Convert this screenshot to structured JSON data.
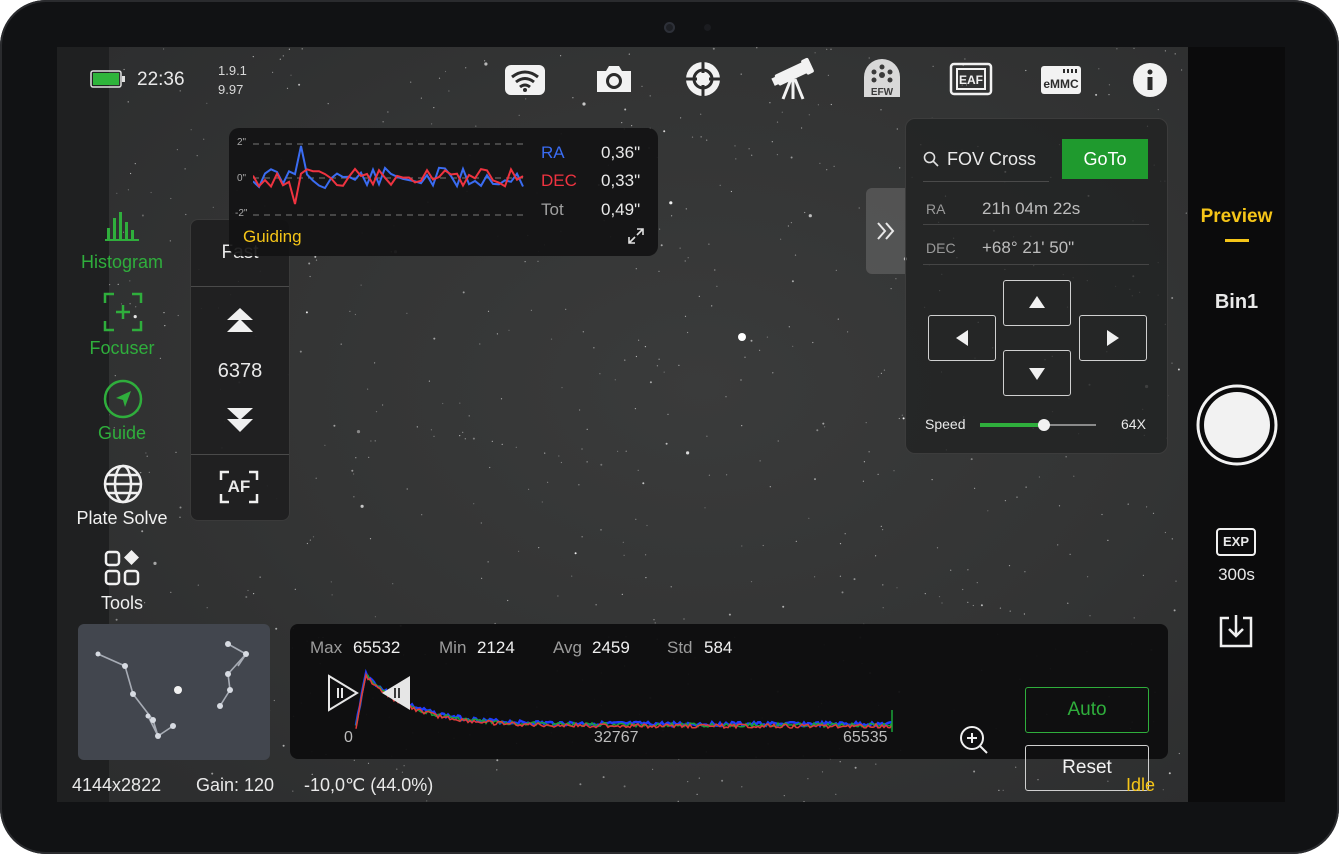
{
  "status_bar": {
    "time": "22:36",
    "version_line1": "1.9.1",
    "version_line2": "9.97",
    "battery_color": "#2fb43b"
  },
  "toolbar_icons": [
    "wifi-icon",
    "camera-icon",
    "crosshair-icon",
    "telescope-icon",
    "efw-icon",
    "eaf-icon",
    "emmc-icon",
    "info-icon"
  ],
  "toolbar_labels": {
    "efw": "EFW",
    "eaf": "EAF",
    "emmc": "eMMC"
  },
  "guiding": {
    "title": "Guiding",
    "axis_top": "2\"",
    "axis_mid": "0\"",
    "axis_bottom": "-2\"",
    "ra_label": "RA",
    "ra_value": "0,36\"",
    "dec_label": "DEC",
    "dec_value": "0,33\"",
    "tot_label": "Tot",
    "tot_value": "0,49\"",
    "ra_color": "#3a6cf2",
    "dec_color": "#ef3340"
  },
  "sidebar": {
    "items": [
      {
        "label": "Histogram",
        "active": true
      },
      {
        "label": "Focuser",
        "active": true
      },
      {
        "label": "Guide",
        "active": true
      },
      {
        "label": "Plate Solve",
        "active": false
      },
      {
        "label": "Tools",
        "active": false
      }
    ],
    "active_color": "#2fae3c"
  },
  "focuser": {
    "speed": "Fast",
    "position": "6378",
    "af_label": "AF"
  },
  "mount": {
    "search_text": "FOV Cross",
    "goto_label": "GoTo",
    "goto_color": "#1f9a2e",
    "ra_label": "RA",
    "ra_value": "21h 04m 22s",
    "dec_label": "DEC",
    "dec_value": "+68° 21' 50\"",
    "speed_label": "Speed",
    "speed_value": "64X",
    "speed_fraction": 0.55
  },
  "right_bar": {
    "mode": "Preview",
    "mode_color": "#f5c518",
    "binning": "Bin1",
    "exp_icon_label": "EXP",
    "exposure": "300s"
  },
  "histogram": {
    "max_label": "Max",
    "max_value": "65532",
    "min_label": "Min",
    "min_value": "2124",
    "avg_label": "Avg",
    "avg_value": "2459",
    "std_label": "Std",
    "std_value": "584",
    "axis_start": "0",
    "axis_mid": "32767",
    "axis_end": "65535",
    "auto_label": "Auto",
    "reset_label": "Reset"
  },
  "footer": {
    "resolution": "4144x2822",
    "gain": "Gain: 120",
    "temperature": "-10,0℃  (44.0%)",
    "state": "Idle",
    "state_color": "#f5c518"
  }
}
